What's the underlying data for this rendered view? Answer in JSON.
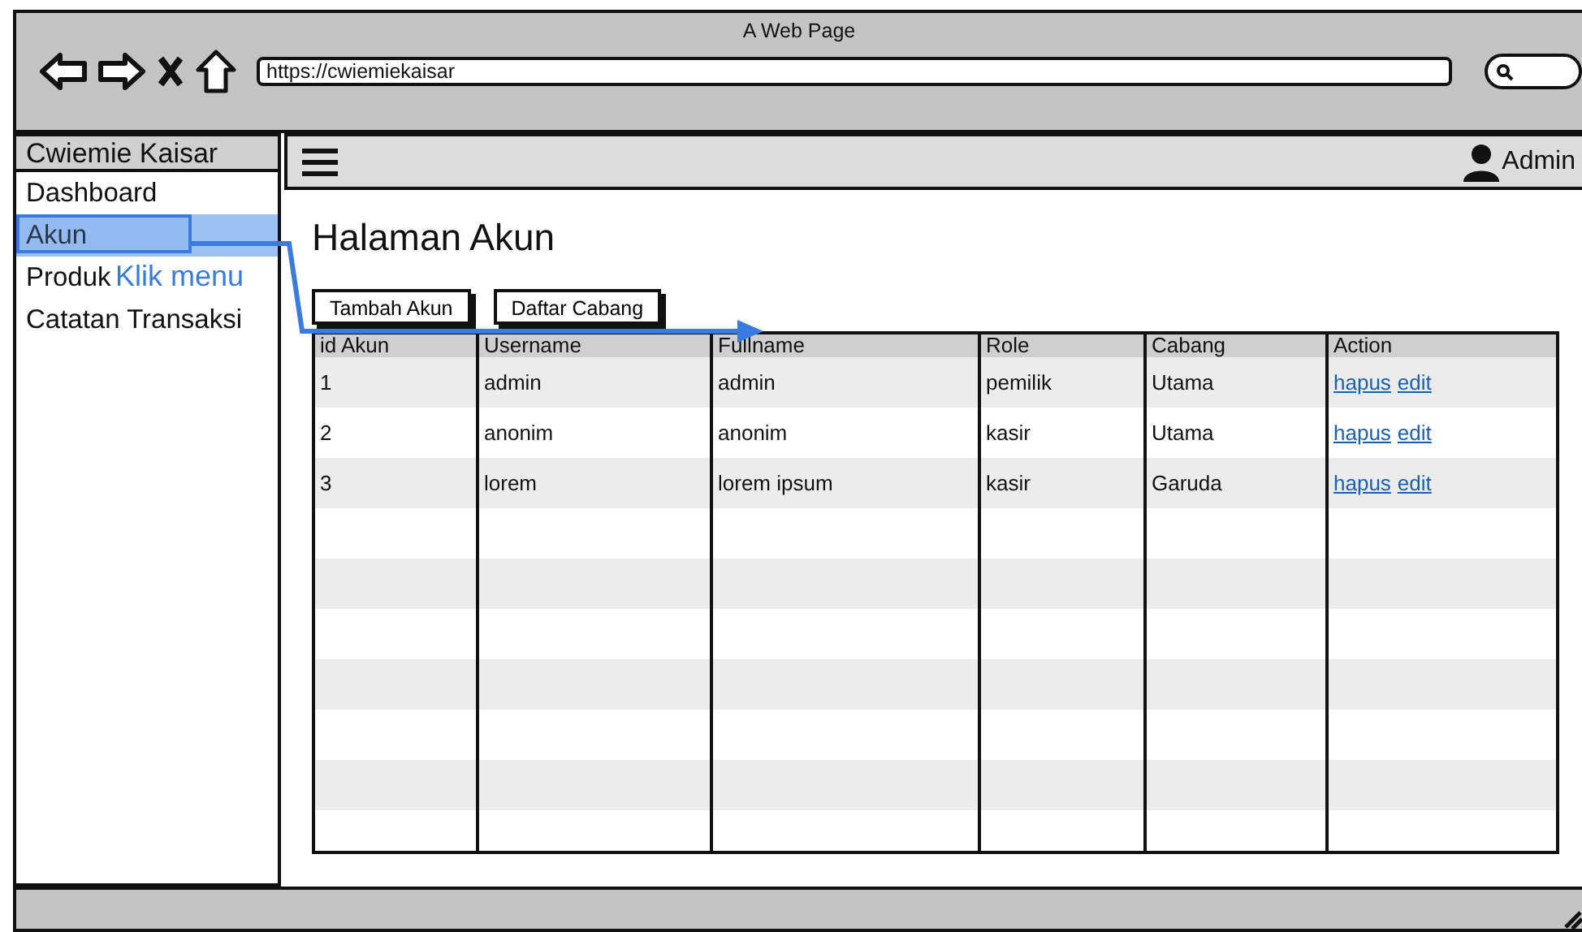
{
  "window": {
    "title": "A Web Page",
    "url": "https://cwiemiekaisar"
  },
  "sidebar": {
    "title": "Cwiemie Kaisar",
    "items": [
      {
        "label": "Dashboard",
        "selected": false
      },
      {
        "label": "Akun",
        "selected": true
      },
      {
        "label": "Produk",
        "selected": false
      },
      {
        "label": "Catatan Transaksi",
        "selected": false
      }
    ]
  },
  "header": {
    "user": "Admin"
  },
  "page": {
    "heading": "Halaman Akun",
    "buttons": [
      "Tambah Akun",
      "Daftar Cabang"
    ]
  },
  "table": {
    "columns": [
      "id Akun",
      "Username",
      "Fullname",
      "Role",
      "Cabang",
      "Action"
    ],
    "rows": [
      {
        "cells": [
          "1",
          "admin",
          "admin",
          "pemilik",
          "Utama"
        ],
        "actions": [
          "hapus",
          "edit"
        ]
      },
      {
        "cells": [
          "2",
          "anonim",
          "anonim",
          "kasir",
          "Utama"
        ],
        "actions": [
          "hapus",
          "edit"
        ]
      },
      {
        "cells": [
          "3",
          "lorem",
          "lorem ipsum",
          "kasir",
          "Garuda"
        ],
        "actions": [
          "hapus",
          "edit"
        ]
      }
    ]
  },
  "annotation": {
    "text": "Klik menu"
  }
}
